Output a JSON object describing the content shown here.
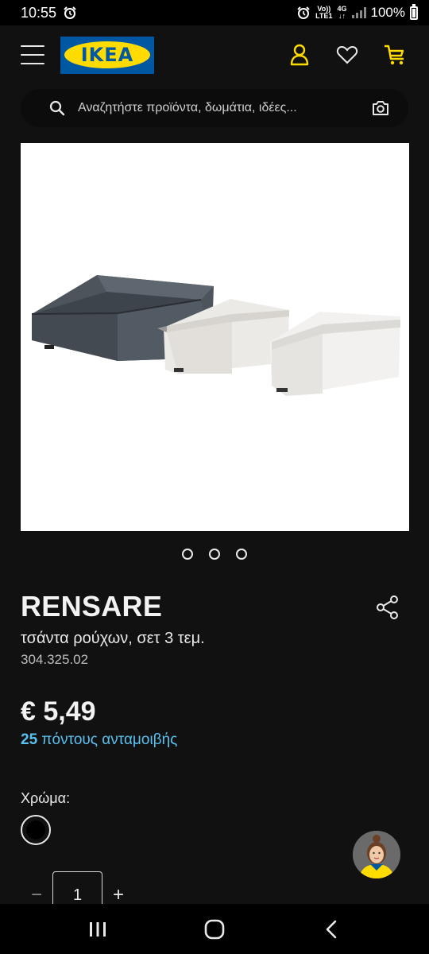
{
  "status_bar": {
    "time": "10:55",
    "lte_top": "Vo))",
    "lte_bottom": "LTE1",
    "net_top": "4G",
    "net_bottom": "↓↑",
    "battery": "100%"
  },
  "header": {
    "logo_text": "IKEA",
    "icons": [
      "menu-icon",
      "account-icon",
      "heart-icon",
      "cart-icon"
    ]
  },
  "search": {
    "placeholder": "Αναζητήστε προϊόντα, δωμάτια, ιδέες..."
  },
  "carousel": {
    "image_count": 3
  },
  "product": {
    "name": "RENSARE",
    "description": "τσάντα ρούχων, σετ 3 τεμ.",
    "article_number": "304.325.02",
    "price": "€ 5,49",
    "reward_points": "25",
    "reward_text": " πόντους ανταμοιβής",
    "color_label": "Χρώμα:",
    "selected_color": "#000000",
    "quantity": "1",
    "quantity_minus": "−",
    "quantity_plus": "+"
  },
  "colors": {
    "background": "#111111",
    "accent_blue": "#58c1ef",
    "ikea_blue": "#0058a3",
    "ikea_yellow": "#ffdb00",
    "header_icons": "#ffdb00"
  }
}
